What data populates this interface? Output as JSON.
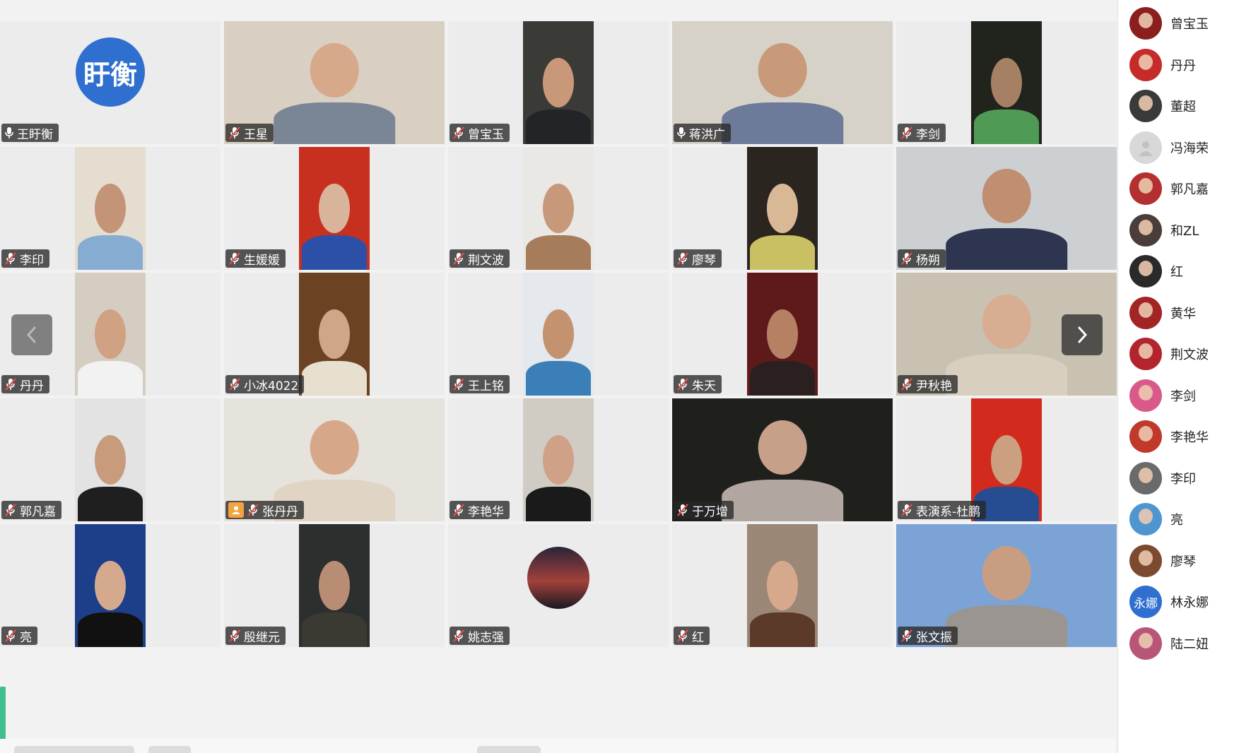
{
  "colors": {
    "speaking_border": "#3fbf8a",
    "label_bg": "#282828",
    "host_badge": "#f4a340",
    "text_avatar": "#2f6fd0"
  },
  "grid": {
    "tiles": [
      {
        "name": "王盱衡",
        "mic": "on",
        "avatar_text": "盱衡",
        "bg": "#2f6fd0",
        "type": "avatar"
      },
      {
        "name": "王星",
        "mic": "off",
        "type": "wide",
        "bg": "#d9cfc2",
        "skin": "#d6a98b",
        "shirt": "#7a8696"
      },
      {
        "name": "曾宝玉",
        "mic": "off",
        "type": "portrait",
        "bg": "#3a3a36",
        "skin": "#c99878",
        "shirt": "#222428"
      },
      {
        "name": "蒋洪广",
        "mic": "on",
        "type": "wide",
        "bg": "#d7d2c8",
        "skin": "#c99a7a",
        "shirt": "#6d7a99",
        "speaking": true
      },
      {
        "name": "李剑",
        "mic": "off",
        "type": "portrait",
        "bg": "#20241c",
        "skin": "#a58064",
        "shirt": "#4f9a55"
      },
      {
        "name": "李印",
        "mic": "off",
        "type": "portrait",
        "bg": "#e4ddd0",
        "skin": "#c49478",
        "shirt": "#86acd1"
      },
      {
        "name": "生媛媛",
        "mic": "off",
        "type": "portrait",
        "bg": "#c7301f",
        "skin": "#d8b49b",
        "shirt": "#2c4fa8"
      },
      {
        "name": "荆文波",
        "mic": "off",
        "type": "portrait",
        "bg": "#e9e8e4",
        "skin": "#c8987a",
        "shirt": "#a67c5b"
      },
      {
        "name": "廖琴",
        "mic": "off",
        "type": "portrait",
        "bg": "#2b2520",
        "skin": "#d9b896",
        "shirt": "#c9c063"
      },
      {
        "name": "杨朔",
        "mic": "off",
        "type": "wide",
        "bg": "#cdd0d2",
        "skin": "#c08f72",
        "shirt": "#2d3550"
      },
      {
        "name": "丹丹",
        "mic": "off",
        "type": "portrait",
        "bg": "#d5cdc1",
        "skin": "#d1a183",
        "shirt": "#f2f2f2"
      },
      {
        "name": "小冰4022",
        "mic": "off",
        "type": "portrait",
        "bg": "#6b4222",
        "skin": "#cfa687",
        "shirt": "#e7dfcf"
      },
      {
        "name": "王上铭",
        "mic": "off",
        "type": "portrait",
        "bg": "#e5e8ec",
        "skin": "#c4926f",
        "shirt": "#3a7fb8"
      },
      {
        "name": "朱天",
        "mic": "off",
        "type": "portrait",
        "bg": "#5e1a1a",
        "skin": "#b68063",
        "shirt": "#2a2020"
      },
      {
        "name": "尹秋艳",
        "mic": "off",
        "type": "wide",
        "bg": "#c9c2b3",
        "skin": "#d8ad92",
        "shirt": "#d8cfc0"
      },
      {
        "name": "郭凡嘉",
        "mic": "off",
        "type": "portrait",
        "bg": "#e3e3e3",
        "skin": "#c99b7d",
        "shirt": "#1f1f1f"
      },
      {
        "name": "张丹丹",
        "mic": "off",
        "host": true,
        "type": "wide",
        "bg": "#e6e2dc",
        "skin": "#d6a889",
        "shirt": "#e0d4c4"
      },
      {
        "name": "李艳华",
        "mic": "off",
        "type": "portrait",
        "bg": "#d0ccc4",
        "skin": "#cfa287",
        "shirt": "#1a1a1a"
      },
      {
        "name": "于万增",
        "mic": "off",
        "type": "wide",
        "bg": "#1f1f1c",
        "skin": "#c7a08a",
        "shirt": "#b1a7a0"
      },
      {
        "name": "表演系-杜鹏",
        "mic": "off",
        "type": "portrait",
        "bg": "#d22a1c",
        "skin": "#caa081",
        "shirt": "#264c92"
      },
      {
        "name": "亮",
        "mic": "off",
        "type": "portrait",
        "bg": "#1d3f8a",
        "skin": "#d4a98e",
        "shirt": "#111111"
      },
      {
        "name": "殷继元",
        "mic": "off",
        "type": "portrait",
        "bg": "#2b2f2e",
        "skin": "#b88d73",
        "shirt": "#3a3a33"
      },
      {
        "name": "姚志强",
        "mic": "off",
        "type": "photo",
        "bg": "#2b2b3a"
      },
      {
        "name": "红",
        "mic": "off",
        "type": "portrait",
        "bg": "#9a8776",
        "skin": "#d6a98c",
        "shirt": "#5b3a2a"
      },
      {
        "name": "张文振",
        "mic": "off",
        "type": "wide",
        "bg": "#7ba3d6",
        "skin": "#c99d82",
        "shirt": "#9a9590"
      }
    ]
  },
  "sidebar": {
    "members": [
      {
        "name": "曾宝玉",
        "bg": "#8b1e1e"
      },
      {
        "name": "丹丹",
        "bg": "#c62b2b"
      },
      {
        "name": "董超",
        "bg": "#3a3a3a"
      },
      {
        "name": "冯海荣",
        "bg": "#d8d8d8",
        "default": true
      },
      {
        "name": "郭凡嘉",
        "bg": "#b43030"
      },
      {
        "name": "和ZL",
        "bg": "#4a3e3a"
      },
      {
        "name": "红",
        "bg": "#2a2a2a"
      },
      {
        "name": "黄华",
        "bg": "#a32424"
      },
      {
        "name": "荆文波",
        "bg": "#b3242f"
      },
      {
        "name": "李剑",
        "bg": "#d95a8a"
      },
      {
        "name": "李艳华",
        "bg": "#c0392b"
      },
      {
        "name": "李印",
        "bg": "#6a6a6a"
      },
      {
        "name": "亮",
        "bg": "#4f95cf"
      },
      {
        "name": "廖琴",
        "bg": "#7b4a2f"
      },
      {
        "name": "林永娜",
        "bg": "#2f6fd0",
        "avatar_text": "永娜"
      },
      {
        "name": "陆二妞",
        "bg": "#b8567a"
      }
    ]
  }
}
